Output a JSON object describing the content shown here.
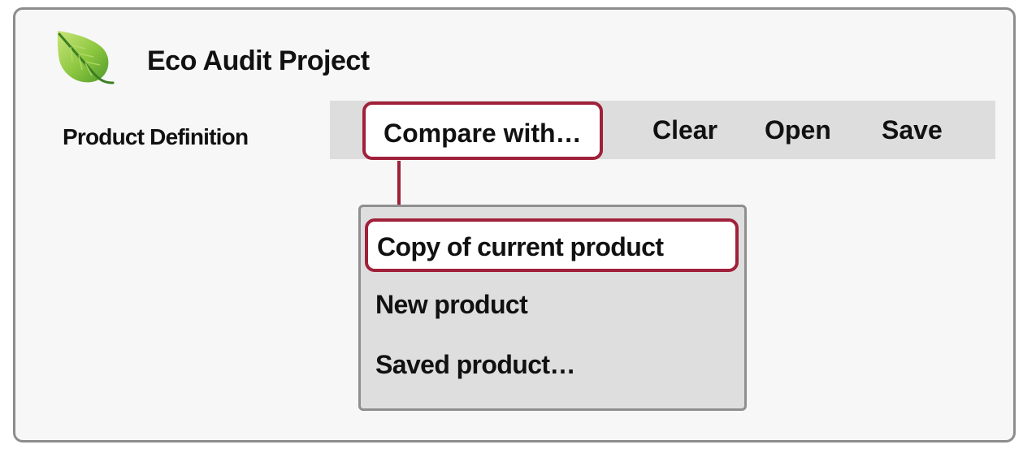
{
  "app": {
    "title": "Eco Audit Project",
    "logo_icon": "leaf-icon"
  },
  "section": {
    "label": "Product Definition"
  },
  "toolbar": {
    "compare_label": "Compare with…",
    "clear_label": "Clear",
    "open_label": "Open",
    "save_label": "Save"
  },
  "dropdown": {
    "items": [
      {
        "label": "Copy of current product",
        "highlighted": true
      },
      {
        "label": "New product",
        "highlighted": false
      },
      {
        "label": "Saved product…",
        "highlighted": false
      }
    ]
  },
  "colors": {
    "highlight_border": "#a0203a",
    "toolbar_bg": "#dddddd",
    "menu_bg": "#dedede",
    "leaf_green": "#8cc63f"
  }
}
